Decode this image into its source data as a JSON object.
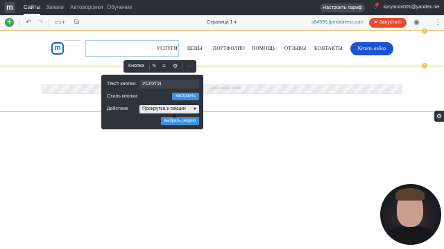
{
  "topbar": {
    "logo": "m",
    "nav": [
      "Сайты",
      "Заявки",
      "Автоворонки",
      "Обучение"
    ],
    "active_nav": "Сайты",
    "tariff_button": "Настроить тариф",
    "user_email": "kzryanov001@yandex.ru",
    "bell_icon": "bell-icon"
  },
  "toolbar": {
    "add_icon": "+",
    "undo_icon": "↶",
    "redo_icon": "↷",
    "device_icon": "▭",
    "preview_icon": "⧉",
    "page_select": "Страница 1 ▾",
    "site_url": "s84599.lpmotortest.com",
    "launch_button": "Запустить",
    "eye_icon": "◉",
    "more_icon": "⋮"
  },
  "site": {
    "logo": "m",
    "menu": [
      "УСЛУГИ",
      "ЦЕНЫ",
      "ПОРТФОЛИО",
      "ПОМОЩЬ",
      "ОТЗЫВЫ",
      "КОНТАКТЫ"
    ],
    "cta": "Купить набор"
  },
  "section2": {
    "placeholder": "...тите сюда блок"
  },
  "button_toolbar": {
    "label": "Кнопка",
    "icons": [
      "pencil-icon",
      "align-icon",
      "gear-icon",
      "more-icon"
    ]
  },
  "popup": {
    "text_label": "Текст кнопки:",
    "text_value": "УСЛУГИ",
    "style_label": "Стиль кнопки:",
    "style_button": "настроить",
    "action_label": "Действие",
    "action_value": "Прокрутка к секции",
    "select_section_button": "выбрать секцию"
  },
  "colors": {
    "accent_blue": "#1c52d4",
    "launch_red": "#ea4b2f",
    "add_green": "#3fa55a",
    "section_border": "#f0c35c"
  }
}
